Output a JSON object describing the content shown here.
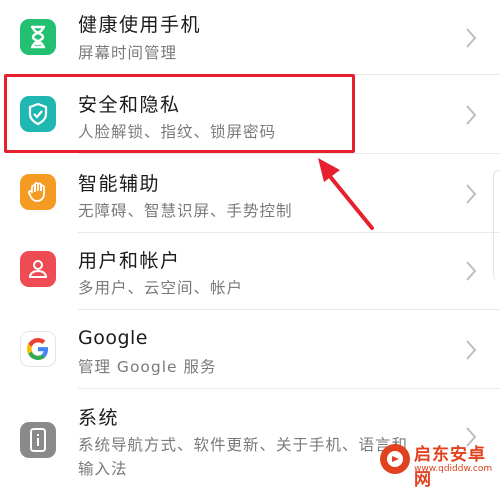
{
  "items": [
    {
      "title": "健康使用手机",
      "subtitle": "屏幕时间管理",
      "icon": "hourglass-icon",
      "color": "#23c071"
    },
    {
      "title": "安全和隐私",
      "subtitle": "人脸解锁、指纹、锁屏密码",
      "icon": "shield-check-icon",
      "color": "#1fb7b2"
    },
    {
      "title": "智能辅助",
      "subtitle": "无障碍、智慧识屏、手势控制",
      "icon": "hand-icon",
      "color": "#f59a23"
    },
    {
      "title": "用户和帐户",
      "subtitle": "多用户、云空间、帐户",
      "icon": "user-icon",
      "color": "#ee4b52"
    },
    {
      "title": "Google",
      "subtitle": "管理 Google 服务",
      "icon": "google-icon",
      "color": "#ffffff"
    },
    {
      "title": "系统",
      "subtitle": "系统导航方式、软件更新、关于手机、语言和",
      "subtitle2": "输入法",
      "icon": "phone-info-icon",
      "color": "#8a8a8a"
    }
  ],
  "annotation": {
    "highlight_color": "#e8202e"
  },
  "watermark": {
    "text": "启东安卓网",
    "url": "www.qdiddw.com"
  }
}
